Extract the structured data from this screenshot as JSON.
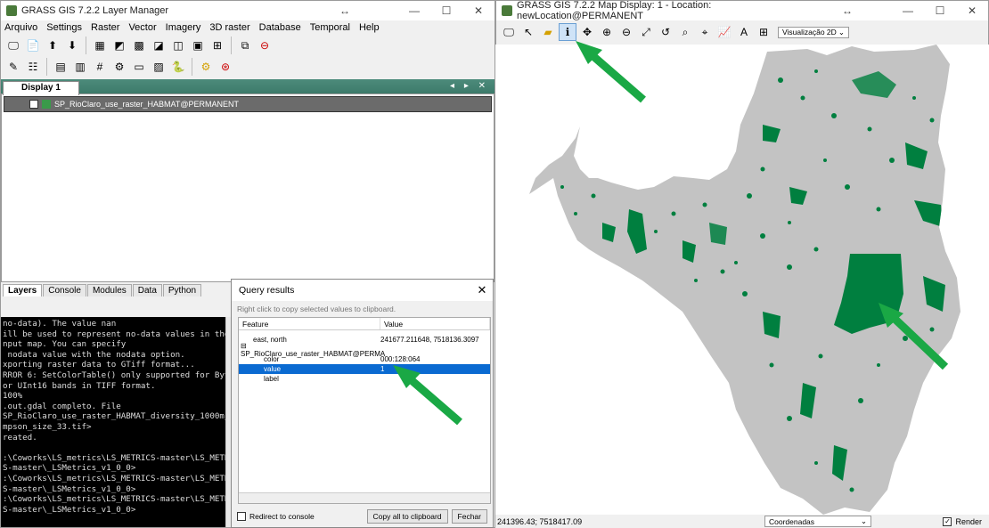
{
  "layer_manager": {
    "title": "GRASS GIS 7.2.2 Layer Manager",
    "menu": [
      "Arquivo",
      "Settings",
      "Raster",
      "Vector",
      "Imagery",
      "3D raster",
      "Database",
      "Temporal",
      "Help"
    ],
    "display_tab": "Display 1",
    "notebook_controls": "◂ ▸ ✕",
    "layer_name": "SP_RioClaro_use_raster_HABMAT@PERMANENT",
    "bottom_tabs": [
      "Layers",
      "Console",
      "Modules",
      "Data",
      "Python"
    ],
    "console_text": "no-data). The value nan\nill be used to represent no-data values in the\nnput map. You can specify\n nodata value with the nodata option.\nxporting raster data to GTiff format...\nRROR 6: SetColorTable() only supported for Byte\nor UInt16 bands in TIFF format.\n100%\n.out.gdal completo. File\nSP_RioClaro_use_raster_HABMAT_diversity_1000m_s\nmpson_size_33.tif>\nreated.\n\n:\\Coworks\\LS_metrics\\LS_METRICS-master\\LS_METRI\nS-master\\_LSMetrics_v1_0_0>\n:\\Coworks\\LS_metrics\\LS_METRICS-master\\LS_METRI\nS-master\\_LSMetrics_v1_0_0>\n:\\Coworks\\LS_metrics\\LS_METRICS-master\\LS_METRI\nS-master\\_LSMetrics_v1_0_0>"
  },
  "query_dialog": {
    "title": "Query results",
    "hint": "Right click to copy selected values to clipboard.",
    "col_feature": "Feature",
    "col_value": "Value",
    "rows": [
      {
        "feature": "east, north",
        "value": "241677.211648, 7518136.3097"
      },
      {
        "feature": "⊟ SP_RioClaro_use_raster_HABMAT@PERMA",
        "value": ""
      },
      {
        "feature": "color",
        "value": "000:128:064"
      },
      {
        "feature": "value",
        "value": "1"
      },
      {
        "feature": "label",
        "value": ""
      }
    ],
    "redirect_label": "Redirect to console",
    "copy_button": "Copy all to clipboard",
    "close_button": "Fechar"
  },
  "map_display": {
    "title": "GRASS GIS 7.2.2 Map Display: 1 - Location: newLocation@PERMANENT",
    "view_mode": "Visualização 2D",
    "coords": "241396.43; 7518417.09",
    "status_mode": "Coordenadas",
    "render_label": "Render"
  },
  "colors": {
    "map_gray": "#c3c3c3",
    "habitat_green": "#007f3f",
    "arrow_green": "#1aa845"
  }
}
